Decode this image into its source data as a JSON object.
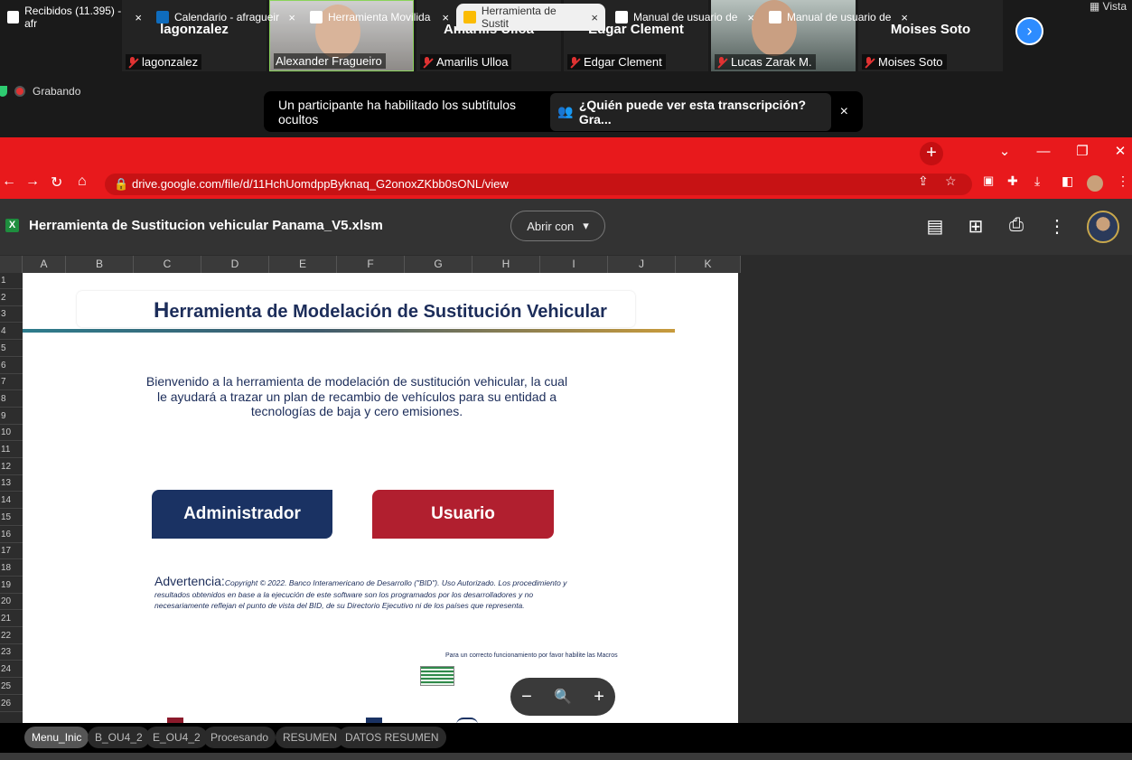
{
  "meeting": {
    "tiles": [
      {
        "display_name": "lagonzalez",
        "label": "lagonzalez"
      },
      {
        "display_name": "",
        "label": "Alexander Fragueiro"
      },
      {
        "display_name": "Amarilis Ulloa",
        "label": "Amarilis Ulloa"
      },
      {
        "display_name": "Edgar Clement",
        "label": "Edgar Clement"
      },
      {
        "display_name": "",
        "label": "Lucas Zarak M."
      },
      {
        "display_name": "Moises Soto",
        "label": "Moises Soto"
      }
    ],
    "next_glyph": "›",
    "view_label": "Vista",
    "recording_label": "Grabando",
    "caption_text": "Un participante ha habilitado los subtítulos ocultos",
    "caption_who": "¿Quién puede ver esta transcripción? Gra...",
    "caption_close": "×"
  },
  "browser": {
    "tabs": [
      {
        "label": "Recibidos (11.395) - afr",
        "icon_color": "#ffffff"
      },
      {
        "label": "Calendario - afragueir",
        "icon_color": "#0f6cbd"
      },
      {
        "label": "Herramienta Movilida",
        "icon_color": "#ffffff"
      },
      {
        "label": "Herramienta de Sustit",
        "icon_color": "#fbbc04"
      },
      {
        "label": "Manual de usuario de",
        "icon_color": "#ffffff"
      },
      {
        "label": "Manual de usuario de",
        "icon_color": "#ffffff"
      }
    ],
    "tab_close": "×",
    "new_tab": "+",
    "url": "drive.google.com/file/d/11HchUomdppByknaq_G2onoxZKbb0sONL/view"
  },
  "viewer": {
    "file_icon": "X",
    "file_title": "Herramienta de Sustitucion vehicular Panama_V5.xlsm",
    "open_with": "Abrir con"
  },
  "sheet": {
    "columns": [
      "A",
      "B",
      "C",
      "D",
      "E",
      "F",
      "G",
      "H",
      "I",
      "J",
      "K"
    ],
    "rows": [
      "1",
      "2",
      "3",
      "4",
      "5",
      "6",
      "7",
      "8",
      "9",
      "10",
      "11",
      "12",
      "13",
      "14",
      "15",
      "16",
      "17",
      "18",
      "19",
      "20",
      "21",
      "22",
      "23",
      "24",
      "25",
      "26"
    ],
    "title_first": "H",
    "title_rest": "erramienta de Modelación de Sustitución Vehicular",
    "welcome": "Bienvenido a la herramienta de modelación de sustitución vehicular, la cual le ayudará a trazar un plan de recambio de vehículos para su entidad a tecnologías de baja y cero emisiones.",
    "admin_button": "Administrador",
    "user_button": "Usuario",
    "warning_label": "Advertencia:",
    "warning_text": "Copyright © 2022. Banco Interamericano de Desarrollo (\"BID\"). Uso Autorizado. Los procedimiento y resultados obtenidos en base a la ejecución de este software son los programados por los desarrolladores y no necesariamente reflejan el punto de vista del BID, de su Directorio Ejecutivo ni de los países que representa.",
    "macro_note": "Para un correcto funcionamiento por favor habilite las Macros",
    "zoom_out": "−",
    "zoom_in": "+"
  },
  "sheet_tabs": [
    "Menu_Inic",
    "B_OU4_2",
    "E_OU4_2",
    "Procesando",
    "RESUMEN",
    "DATOS RESUMEN"
  ],
  "colors": {
    "tab_red": "#e8191c",
    "admin_blue": "#1a3263",
    "user_red": "#b11f2f"
  }
}
